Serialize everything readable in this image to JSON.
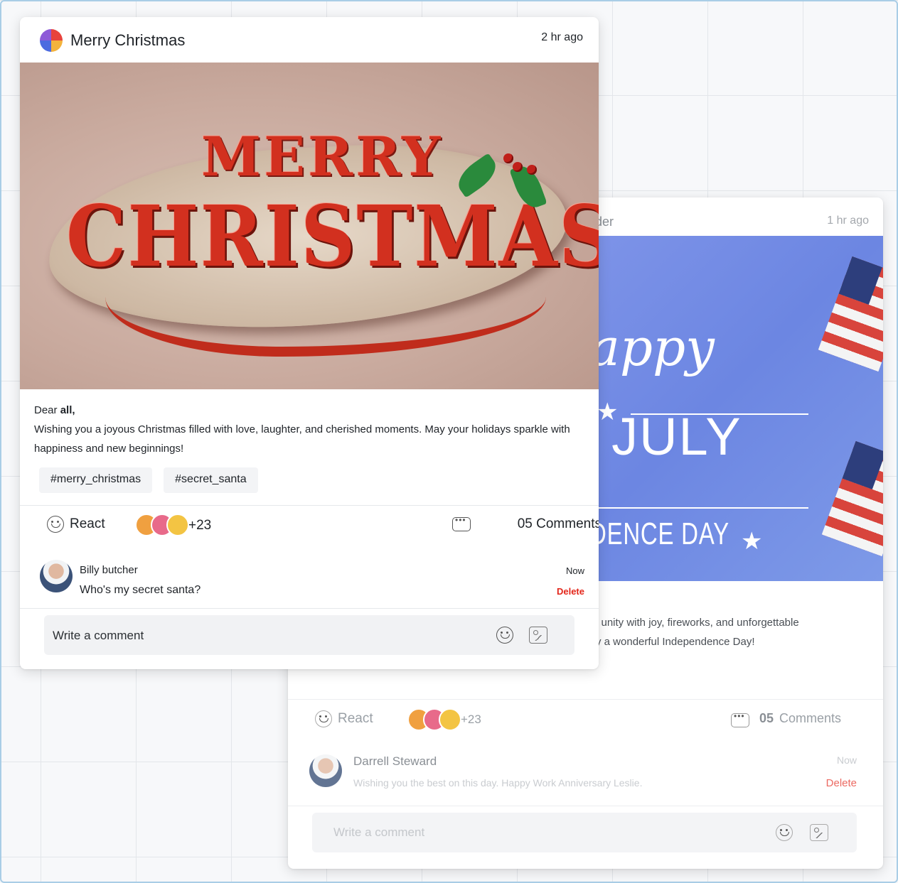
{
  "back_post": {
    "title_fragment": "der",
    "time": "1 hr ago",
    "image_text": {
      "happy": "appy",
      "july": "f JULY",
      "independence": "DENCE DAY"
    },
    "body_line1": "l unity with joy, fireworks, and unforgettable",
    "body_line2": "y a wonderful Independence Day!",
    "react_label": "React",
    "react_count": "+23",
    "comments_count": "05",
    "comments_label": "Comments",
    "comment": {
      "author": "Darrell Steward",
      "text": "Wishing you the best on this day. Happy Work Anniversary Leslie.",
      "time": "Now",
      "delete": "Delete"
    },
    "input_placeholder": "Write a comment"
  },
  "front_post": {
    "title": "Merry Christmas",
    "time": "2 hr ago",
    "image_text": {
      "merry": "MERRY",
      "christmas": "CHRISTMAS"
    },
    "greeting_prefix": "Dear ",
    "greeting_bold": "all,",
    "message": "Wishing you a joyous Christmas filled with love, laughter, and cherished moments. May your holidays sparkle with happiness and new beginnings!",
    "tags": [
      "#merry_christmas",
      "#secret_santa"
    ],
    "react_label": "React",
    "react_count": "+23",
    "comments_label": "05 Comments",
    "comment": {
      "author": "Billy butcher",
      "text": "Who's my secret santa?",
      "time": "Now",
      "delete": "Delete"
    },
    "input_placeholder": "Write a comment"
  },
  "colors": {
    "delete": "#e3261a",
    "july_blue": "#6c86e2",
    "christmas_red": "#d2301f"
  }
}
